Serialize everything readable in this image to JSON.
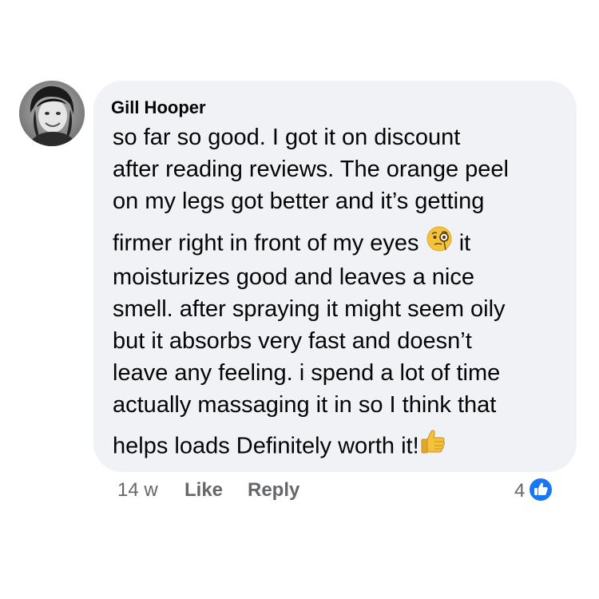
{
  "comment": {
    "author": "Gill Hooper",
    "lines": [
      "so far so good.  I got it on discount",
      "after reading reviews. The orange peel",
      "on my legs got better and it’s getting",
      "firmer right in front of my eyes ",
      "it",
      "moisturizes good and leaves a nice",
      "smell. after spraying it might seem oily",
      "but it absorbs very fast and doesn’t",
      "leave any feeling. i spend a lot of time",
      "actually massaging it in so I think that",
      "helps loads Definitely worth it!"
    ],
    "inline_emoji_icons": [
      "face-with-monocle-icon",
      "thumbs-up-icon"
    ]
  },
  "actions": {
    "time": "14 w",
    "like_label": "Like",
    "reply_label": "Reply"
  },
  "reactions": {
    "count": "4",
    "icon": "like-reaction-icon",
    "color": "#1877f2"
  },
  "colors": {
    "bubble": "#f0f2f5",
    "text": "#050505",
    "meta": "#65676b"
  }
}
